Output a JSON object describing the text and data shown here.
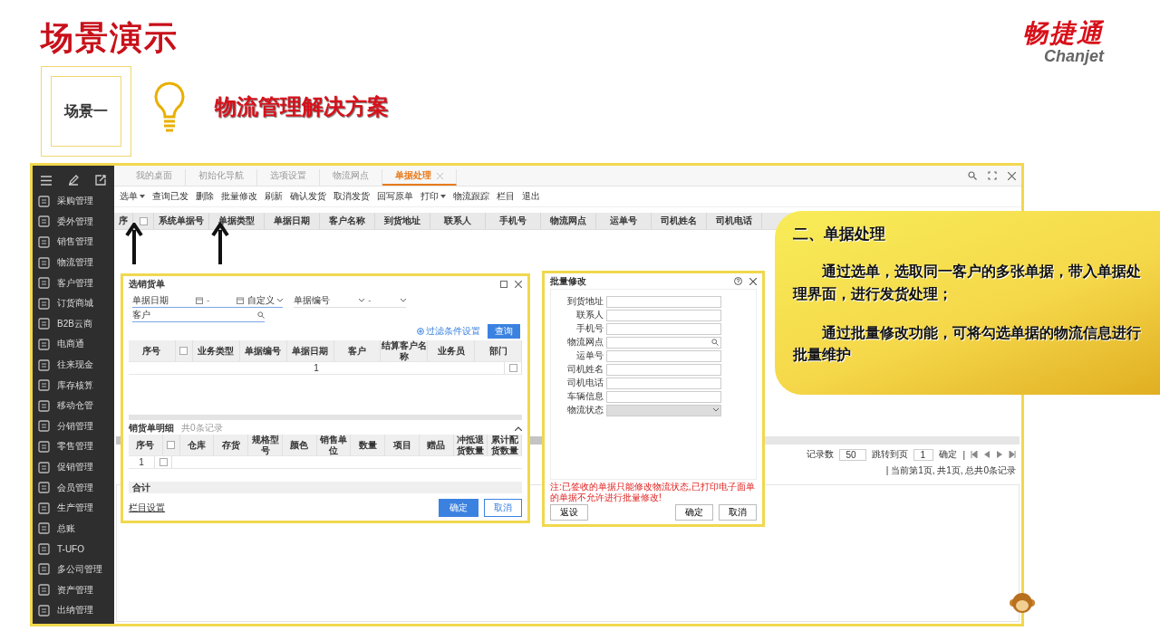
{
  "slide": {
    "title": "场景演示",
    "scene_label": "场景一",
    "headline": "物流管理解决方案",
    "logo": {
      "name": "畅捷通",
      "latin": "Chanjet"
    }
  },
  "app": {
    "sidebar": {
      "items": [
        {
          "label": "采购管理"
        },
        {
          "label": "委外管理"
        },
        {
          "label": "销售管理"
        },
        {
          "label": "物流管理"
        },
        {
          "label": "客户管理"
        },
        {
          "label": "订货商城"
        },
        {
          "label": "B2B云商"
        },
        {
          "label": "电商通"
        },
        {
          "label": "往来现金"
        },
        {
          "label": "库存核算"
        },
        {
          "label": "移动仓管"
        },
        {
          "label": "分销管理"
        },
        {
          "label": "零售管理"
        },
        {
          "label": "促销管理"
        },
        {
          "label": "会员管理"
        },
        {
          "label": "生产管理"
        },
        {
          "label": "总账"
        },
        {
          "label": "T-UFO"
        },
        {
          "label": "多公司管理"
        },
        {
          "label": "资产管理"
        },
        {
          "label": "出纳管理"
        }
      ]
    },
    "tabs": [
      {
        "label": "我的桌面",
        "selected": false,
        "closable": false
      },
      {
        "label": "初始化导航",
        "selected": false,
        "closable": false
      },
      {
        "label": "选项设置",
        "selected": false,
        "closable": false
      },
      {
        "label": "物流网点",
        "selected": false,
        "closable": false
      },
      {
        "label": "单据处理",
        "selected": true,
        "closable": true
      }
    ],
    "toolbar": [
      {
        "label": "选单",
        "dropdown": true
      },
      {
        "label": "查询已发",
        "dropdown": false
      },
      {
        "label": "删除",
        "dropdown": false
      },
      {
        "label": "批量修改",
        "dropdown": false
      },
      {
        "label": "刷新",
        "dropdown": false
      },
      {
        "label": "确认发货",
        "dropdown": false
      },
      {
        "label": "取消发货",
        "dropdown": false
      },
      {
        "label": "回写原单",
        "dropdown": false
      },
      {
        "label": "打印",
        "dropdown": true
      },
      {
        "label": "物流跟踪",
        "dropdown": false
      },
      {
        "label": "栏目",
        "dropdown": false
      },
      {
        "label": "退出",
        "dropdown": false
      }
    ],
    "table": {
      "columns": [
        {
          "kind": "text",
          "label": "序"
        },
        {
          "kind": "checkbox",
          "checked": false
        },
        {
          "kind": "text",
          "label": "系统单据号"
        },
        {
          "kind": "text",
          "label": "单据类型"
        },
        {
          "kind": "text",
          "label": "单据日期"
        },
        {
          "kind": "text",
          "label": "客户名称"
        },
        {
          "kind": "text",
          "label": "到货地址"
        },
        {
          "kind": "text",
          "label": "联系人"
        },
        {
          "kind": "text",
          "label": "手机号"
        },
        {
          "kind": "text",
          "label": "物流网点"
        },
        {
          "kind": "text",
          "label": "运单号"
        },
        {
          "kind": "text",
          "label": "司机姓名"
        },
        {
          "kind": "text",
          "label": "司机电话"
        }
      ]
    },
    "pager": {
      "page_size_label": "记录数",
      "page_size": "50",
      "jump_label": "跳转到页",
      "jump_value": "1",
      "confirm": "确定",
      "separator": "|",
      "status": "| 当前第1页, 共1页, 总共0条记录"
    }
  },
  "select_dialog": {
    "title": "选销货单",
    "filters": [
      {
        "kind": "date_range",
        "label": "单据日期",
        "separator": "-",
        "preset": "自定义"
      },
      {
        "kind": "range",
        "label": "单据编号",
        "separator": "-"
      },
      {
        "kind": "search",
        "label": "客户"
      }
    ],
    "filter_settings": "过滤条件设置",
    "query": "查询",
    "table": {
      "columns": [
        {
          "kind": "text",
          "label": "序号"
        },
        {
          "kind": "checkbox",
          "checked": false
        },
        {
          "kind": "text",
          "label": "业务类型"
        },
        {
          "kind": "text",
          "label": "单据编号"
        },
        {
          "kind": "text",
          "label": "单据日期"
        },
        {
          "kind": "text",
          "label": "客户"
        },
        {
          "kind": "text",
          "label": "结算客户名称"
        },
        {
          "kind": "text",
          "label": "业务员"
        },
        {
          "kind": "text",
          "label": "部门"
        }
      ],
      "rows": [
        {
          "index": "1",
          "checked": false
        }
      ]
    },
    "detail": {
      "title": "销货单明细",
      "count": "共0条记录",
      "columns": [
        {
          "kind": "text",
          "label": "序号"
        },
        {
          "kind": "checkbox",
          "checked": false
        },
        {
          "kind": "text",
          "label": "仓库"
        },
        {
          "kind": "text",
          "label": "存货"
        },
        {
          "kind": "text",
          "label": "规格型号"
        },
        {
          "kind": "text",
          "label": "颜色"
        },
        {
          "kind": "text",
          "label": "销售单位"
        },
        {
          "kind": "text",
          "label": "数量"
        },
        {
          "kind": "text",
          "label": "项目"
        },
        {
          "kind": "text",
          "label": "赠品"
        },
        {
          "kind": "text",
          "label": "冲抵退货数量"
        },
        {
          "kind": "text",
          "label": "累计配货数量"
        }
      ],
      "rows": [
        {
          "index": "1",
          "checked": false
        }
      ],
      "total": "合计"
    },
    "column_settings": "栏目设置",
    "ok": "确定",
    "cancel": "取消"
  },
  "batch_dialog": {
    "title": "批量修改",
    "fields": [
      {
        "label": "到货地址",
        "kind": "text",
        "disabled": false
      },
      {
        "label": "联系人",
        "kind": "text",
        "disabled": false
      },
      {
        "label": "手机号",
        "kind": "text",
        "disabled": false
      },
      {
        "label": "物流网点",
        "kind": "search",
        "disabled": false
      },
      {
        "label": "运单号",
        "kind": "text",
        "disabled": false
      },
      {
        "label": "司机姓名",
        "kind": "text",
        "disabled": false
      },
      {
        "label": "司机电话",
        "kind": "text",
        "disabled": false
      },
      {
        "label": "车辆信息",
        "kind": "text",
        "disabled": false
      },
      {
        "label": "物流状态",
        "kind": "select",
        "disabled": true
      }
    ],
    "note": "注:已签收的单据只能修改物流状态,已打印电子面单的单据不允许进行批量修改!",
    "reset": "返设",
    "ok": "确定",
    "cancel": "取消"
  },
  "callout": {
    "heading": "二、单据处理",
    "paragraphs": [
      "通过选单，选取同一客户的多张单据，带入单据处理界面，进行发货处理；",
      "通过批量修改功能，可将勾选单据的物流信息进行批量维护"
    ]
  }
}
